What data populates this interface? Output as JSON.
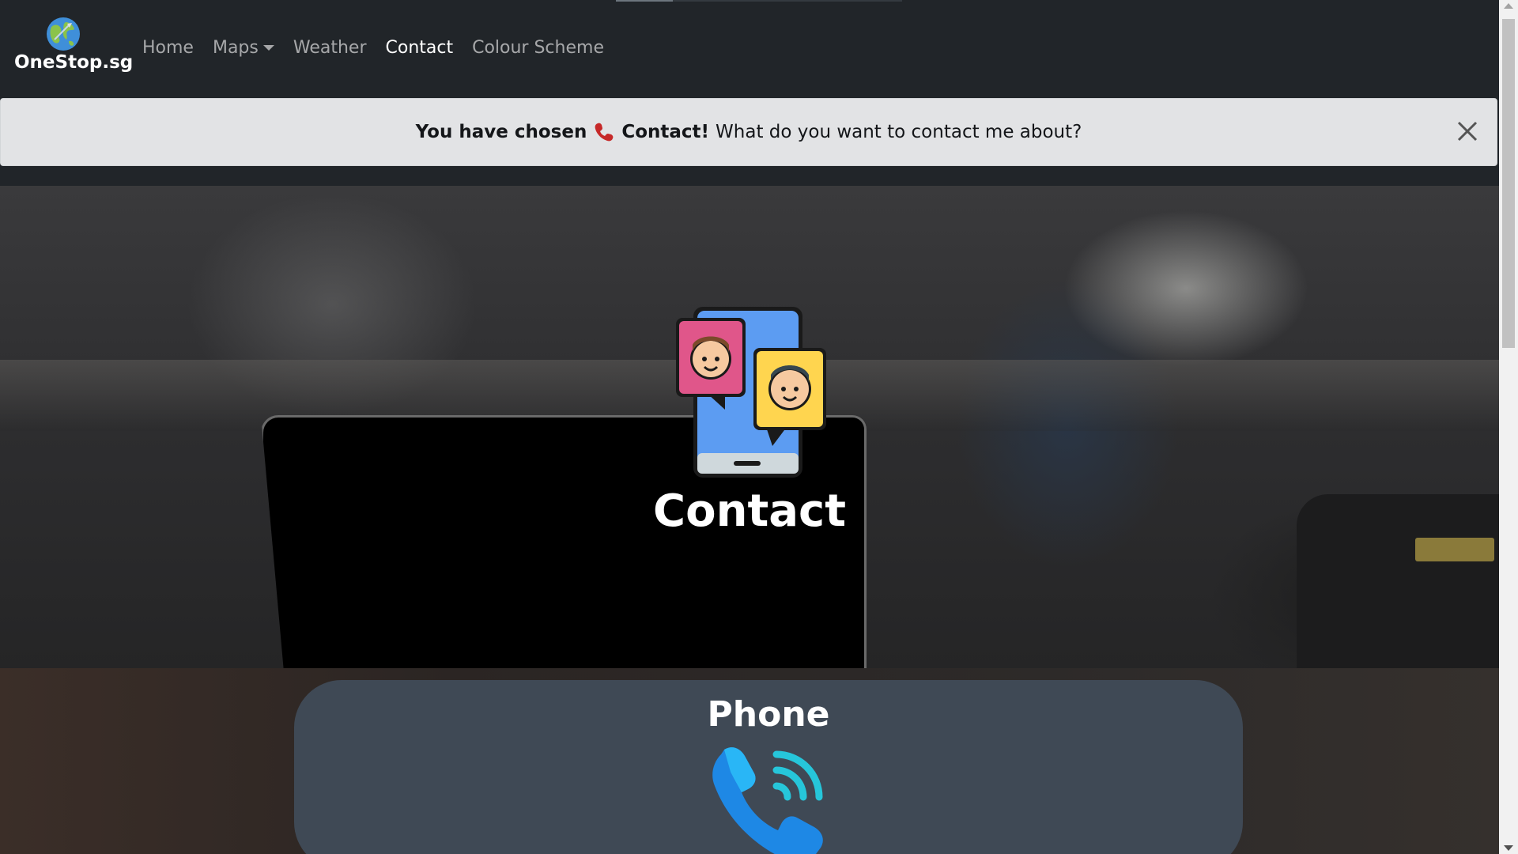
{
  "navbar": {
    "brand": "OneStop.sg",
    "links": [
      {
        "label": "Home"
      },
      {
        "label": "Maps"
      },
      {
        "label": "Weather"
      },
      {
        "label": "Contact"
      },
      {
        "label": "Colour Scheme"
      }
    ]
  },
  "alert": {
    "prefix": "You have chosen",
    "emphasis": "Contact!",
    "message": "What do you want to contact me about?"
  },
  "hero": {
    "title": "Contact"
  },
  "card": {
    "title": "Phone"
  }
}
